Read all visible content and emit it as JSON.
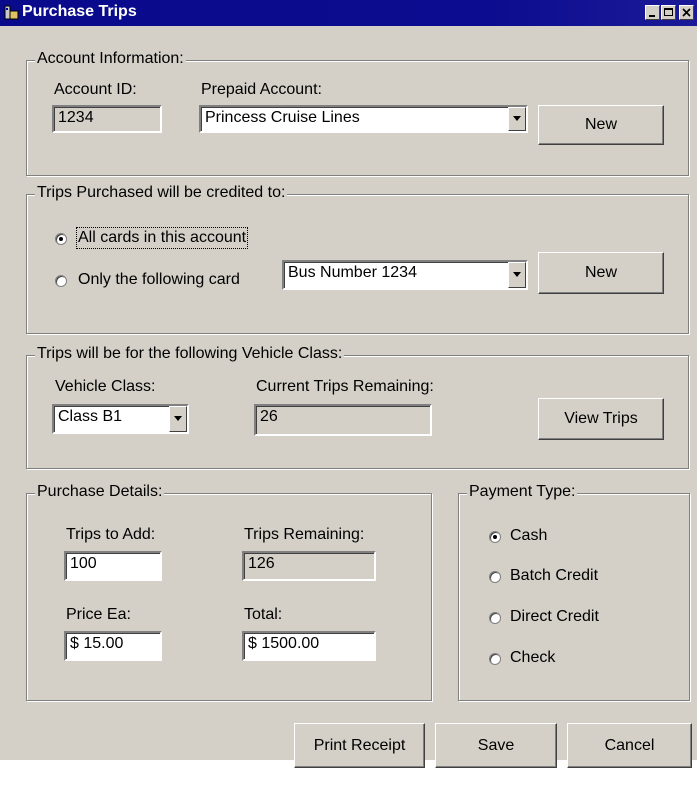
{
  "window": {
    "title": "Purchase Trips"
  },
  "account": {
    "legend": "Account Information:",
    "id_label": "Account ID:",
    "id_value": "1234",
    "prepaid_label": "Prepaid Account:",
    "prepaid_value": "Princess Cruise Lines",
    "new_label": "New"
  },
  "credit": {
    "legend": "Trips Purchased will be credited to:",
    "options": [
      {
        "label": "All cards in this account",
        "selected": true
      },
      {
        "label": "Only the following card",
        "selected": false
      }
    ],
    "card_value": "Bus Number 1234",
    "new_label": "New"
  },
  "vehicle": {
    "legend": "Trips will be for the following Vehicle Class:",
    "class_label": "Vehicle Class:",
    "class_value": "Class B1",
    "remaining_label": "Current Trips Remaining:",
    "remaining_value": "26",
    "view_label": "View Trips"
  },
  "purchase": {
    "legend": "Purchase Details:",
    "trips_add_label": "Trips to Add:",
    "trips_add_value": "100",
    "trips_remaining_label": "Trips Remaining:",
    "trips_remaining_value": "126",
    "price_label": "Price Ea:",
    "price_value": "$ 15.00",
    "total_label": "Total:",
    "total_value": "$ 1500.00"
  },
  "payment": {
    "legend": "Payment Type:",
    "options": [
      {
        "label": "Cash",
        "selected": true
      },
      {
        "label": "Batch Credit",
        "selected": false
      },
      {
        "label": "Direct Credit",
        "selected": false
      },
      {
        "label": "Check",
        "selected": false
      }
    ]
  },
  "footer": {
    "print_label": "Print Receipt",
    "save_label": "Save",
    "cancel_label": "Cancel"
  }
}
